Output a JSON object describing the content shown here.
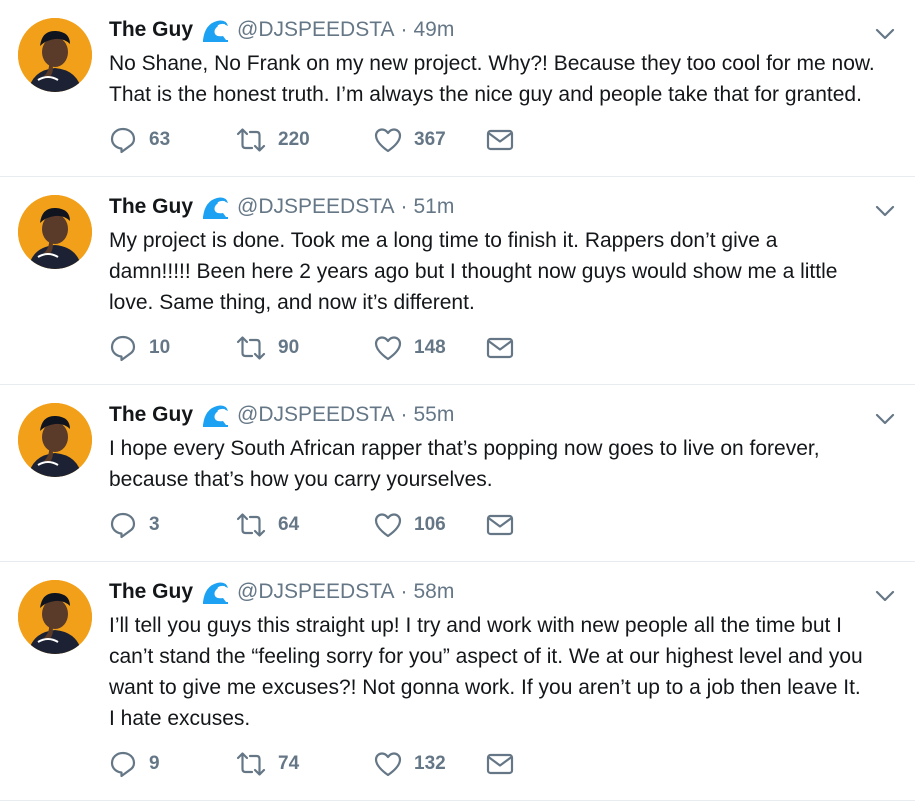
{
  "tweets": [
    {
      "name": "The Guy",
      "handle": "@DJSPEEDSTA",
      "separator": "·",
      "time": "49m",
      "lines": [
        "No Shane, No Frank on my new project. Why?! Because they too cool for me now.",
        "That is the honest truth. I’m always the nice guy and people take that for granted."
      ],
      "replies": "63",
      "retweets": "220",
      "likes": "367"
    },
    {
      "name": "The Guy",
      "handle": "@DJSPEEDSTA",
      "separator": "·",
      "time": "51m",
      "lines": [
        "My project is done. Took me a long time to finish it. Rappers don’t give a",
        "damn!!!!! Been here 2 years ago but I thought now guys would show me a little",
        "love. Same thing, and now it’s different."
      ],
      "replies": "10",
      "retweets": "90",
      "likes": "148"
    },
    {
      "name": "The Guy",
      "handle": "@DJSPEEDSTA",
      "separator": "·",
      "time": "55m",
      "lines": [
        "I hope every South African rapper that’s popping now goes to live on forever,",
        "because that’s how you carry yourselves."
      ],
      "replies": "3",
      "retweets": "64",
      "likes": "106"
    },
    {
      "name": "The Guy",
      "handle": "@DJSPEEDSTA",
      "separator": "·",
      "time": "58m",
      "lines": [
        "I’ll tell you guys this straight up! I try and work with new people all the time but I",
        "can’t stand the “feeling sorry for you” aspect of it. We at our highest level and you",
        "want to give me excuses?! Not gonna work. If you aren’t up to a job then leave It.",
        "I hate excuses."
      ],
      "replies": "9",
      "retweets": "74",
      "likes": "132"
    }
  ],
  "icons": {
    "name_emoji": "water-wave-icon",
    "menu": "chevron-down-icon",
    "reply": "reply-icon",
    "retweet": "retweet-icon",
    "like": "heart-icon",
    "dm": "envelope-icon"
  },
  "colors": {
    "text": "#14171a",
    "secondary": "#657786",
    "divider": "#e6ecf0",
    "wave": "#1da1f2",
    "avatar_bg": "#f2a01a"
  }
}
